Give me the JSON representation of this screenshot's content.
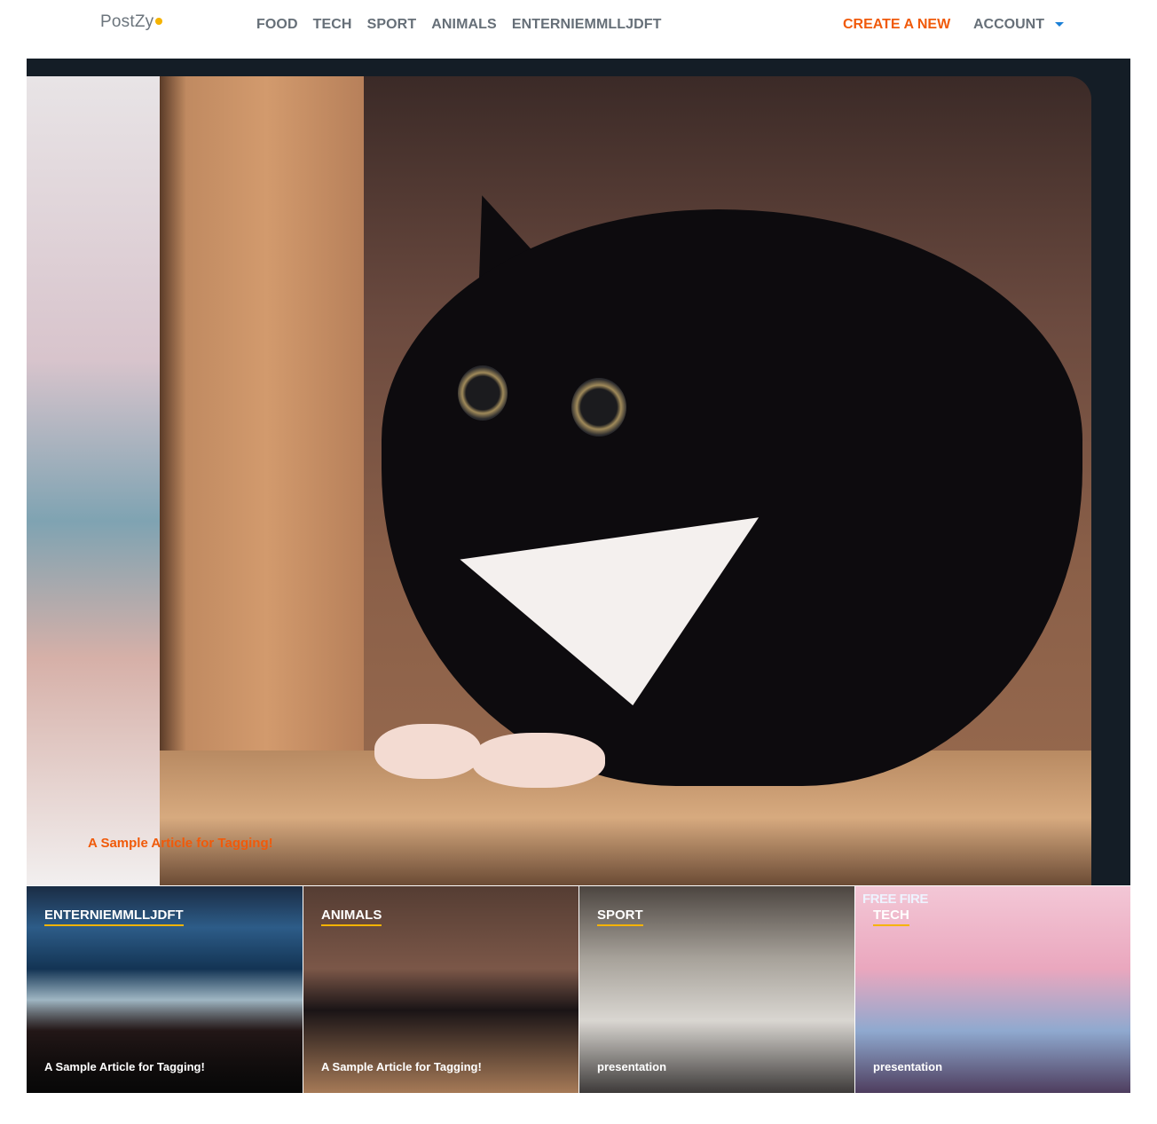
{
  "header": {
    "logo_text": "PostZy",
    "nav": [
      "FOOD",
      "TECH",
      "SPORT",
      "ANIMALS",
      "ENTERNIEMMLLJDFT"
    ],
    "create_label": "CREATE A NEW",
    "account_label": "ACCOUNT",
    "caret_icon": "chevron-down-icon"
  },
  "hero": {
    "title": "A Sample Article for Tagging!",
    "image": "cat-in-box-photo"
  },
  "cards": [
    {
      "category": "ENTERNIEMMLLJDFT",
      "title": "A Sample Article for Tagging!",
      "image": "control-room-photo"
    },
    {
      "category": "ANIMALS",
      "title": "A Sample Article for Tagging!",
      "image": "cat-in-box-photo"
    },
    {
      "category": "SPORT",
      "title": "presentation",
      "image": "office-team-photo"
    },
    {
      "category": "TECH",
      "title": "presentation",
      "image": "game-artwork",
      "watermark": "FREE FIRE"
    }
  ],
  "colors": {
    "accent": "#f05a0a",
    "logo_dot": "#f5b300",
    "nav_text": "#666f78",
    "hero_bg": "#141d26",
    "caret": "#1a7fd6"
  }
}
